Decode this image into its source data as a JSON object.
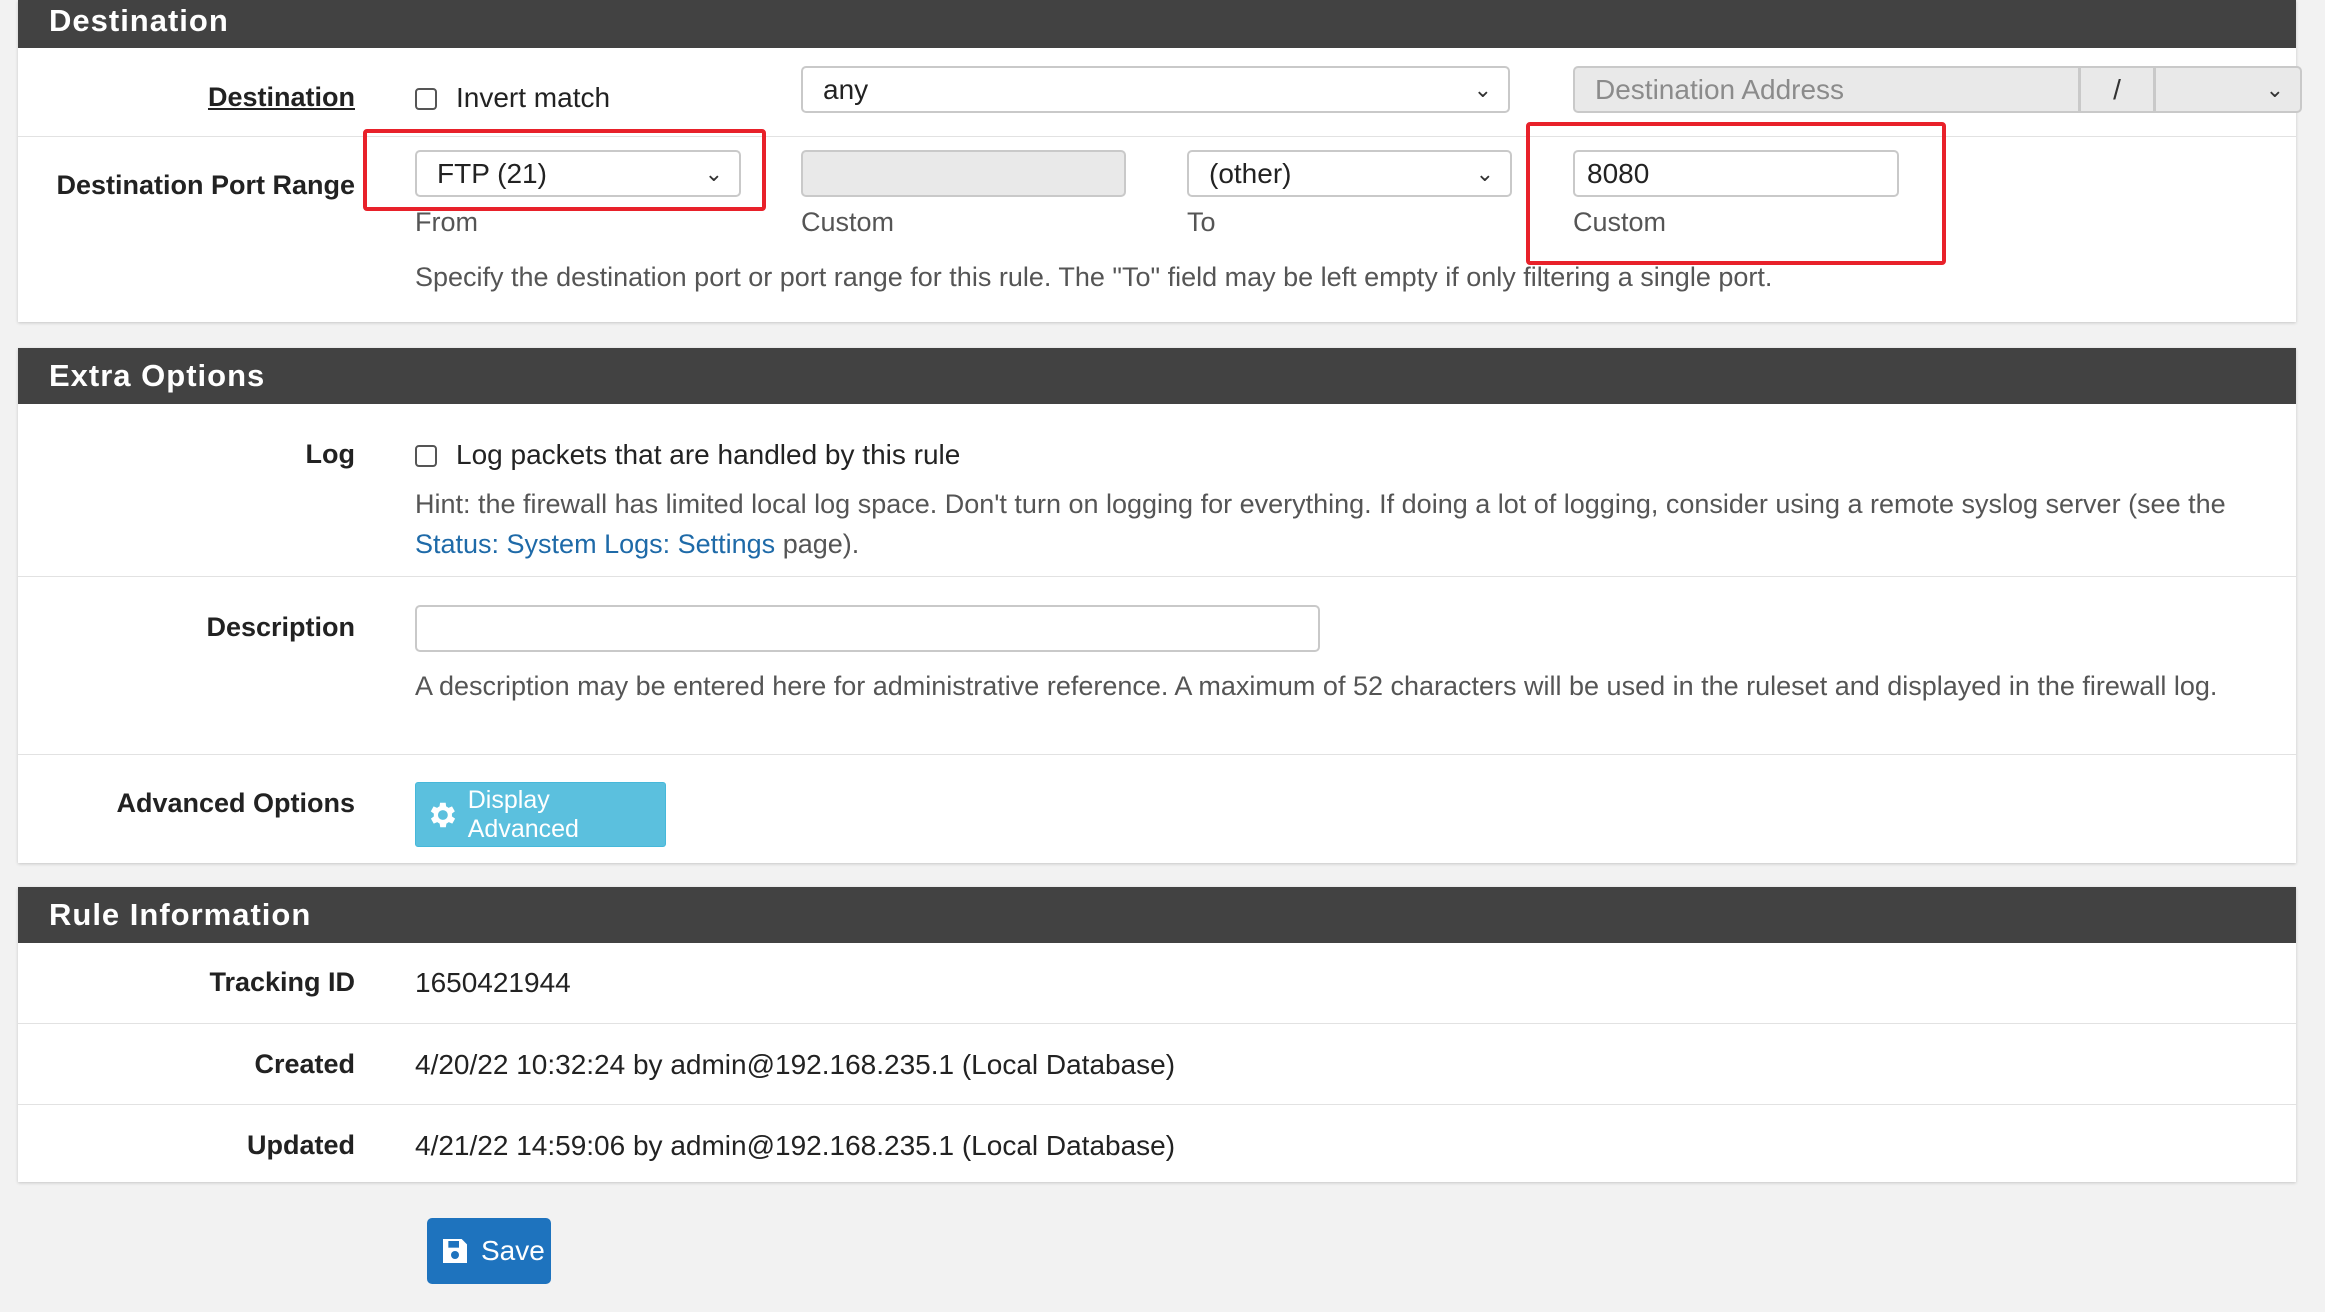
{
  "destination_panel": {
    "title": "Destination",
    "destination": {
      "label": "Destination",
      "invert_label": "Invert match",
      "invert_checked": false,
      "type_select": "any",
      "address_placeholder": "Destination Address",
      "slash": "/",
      "mask_select": ""
    },
    "port_range": {
      "label": "Destination Port Range",
      "from_select": "FTP (21)",
      "from_label": "From",
      "from_custom_value": "",
      "from_custom_label": "Custom",
      "to_select": "(other)",
      "to_label": "To",
      "to_custom_value": "8080",
      "to_custom_label": "Custom",
      "help": "Specify the destination port or port range for this rule. The \"To\" field may be left empty if only filtering a single port."
    }
  },
  "extra_options_panel": {
    "title": "Extra Options",
    "log": {
      "label": "Log",
      "checkbox_label": "Log packets that are handled by this rule",
      "checked": false,
      "hint_prefix": "Hint: the firewall has limited local log space. Don't turn on logging for everything. If doing a lot of logging, consider using a remote syslog server (see the ",
      "hint_link": "Status: System Logs: Settings",
      "hint_suffix": " page)."
    },
    "description": {
      "label": "Description",
      "value": "",
      "help": "A description may be entered here for administrative reference. A maximum of 52 characters will be used in the ruleset and displayed in the firewall log."
    },
    "advanced": {
      "label": "Advanced Options",
      "button_label": "Display Advanced",
      "button_icon": "gear-icon"
    }
  },
  "rule_info_panel": {
    "title": "Rule Information",
    "tracking_id": {
      "label": "Tracking ID",
      "value": "1650421944"
    },
    "created": {
      "label": "Created",
      "value": "4/20/22 10:32:24 by admin@192.168.235.1 (Local Database)"
    },
    "updated": {
      "label": "Updated",
      "value": "4/21/22 14:59:06 by admin@192.168.235.1 (Local Database)"
    }
  },
  "save_button": {
    "label": "Save",
    "icon": "save-icon"
  },
  "colors": {
    "panel_heading": "#424242",
    "info_button": "#5bc0de",
    "primary_button": "#1e73be",
    "highlight_box": "#e8212a",
    "link": "#1e6aa8"
  }
}
